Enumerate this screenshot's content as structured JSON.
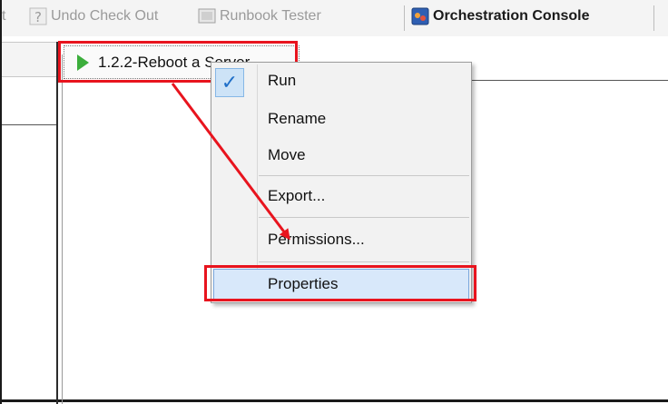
{
  "toolbar": {
    "items": [
      {
        "label": "Undo Check Out",
        "icon": "undo-checkout-icon"
      },
      {
        "label": "Runbook Tester",
        "icon": "runbook-tester-icon"
      },
      {
        "label": "Orchestration Console",
        "icon": "orchestration-console-icon"
      }
    ],
    "leading_fragment": "t"
  },
  "tab": {
    "label": "1.2.2-Reboot a Server",
    "icon": "play-icon"
  },
  "context_menu": {
    "items": [
      {
        "label": "Run",
        "checked": true
      },
      {
        "label": "Rename"
      },
      {
        "label": "Move"
      },
      {
        "label": "Export..."
      },
      {
        "label": "Permissions..."
      },
      {
        "label": "Properties",
        "highlighted": true
      }
    ]
  },
  "colors": {
    "annotation_red": "#e8141e",
    "play_green": "#3cae3c",
    "menu_hover": "#d8e8fa"
  }
}
